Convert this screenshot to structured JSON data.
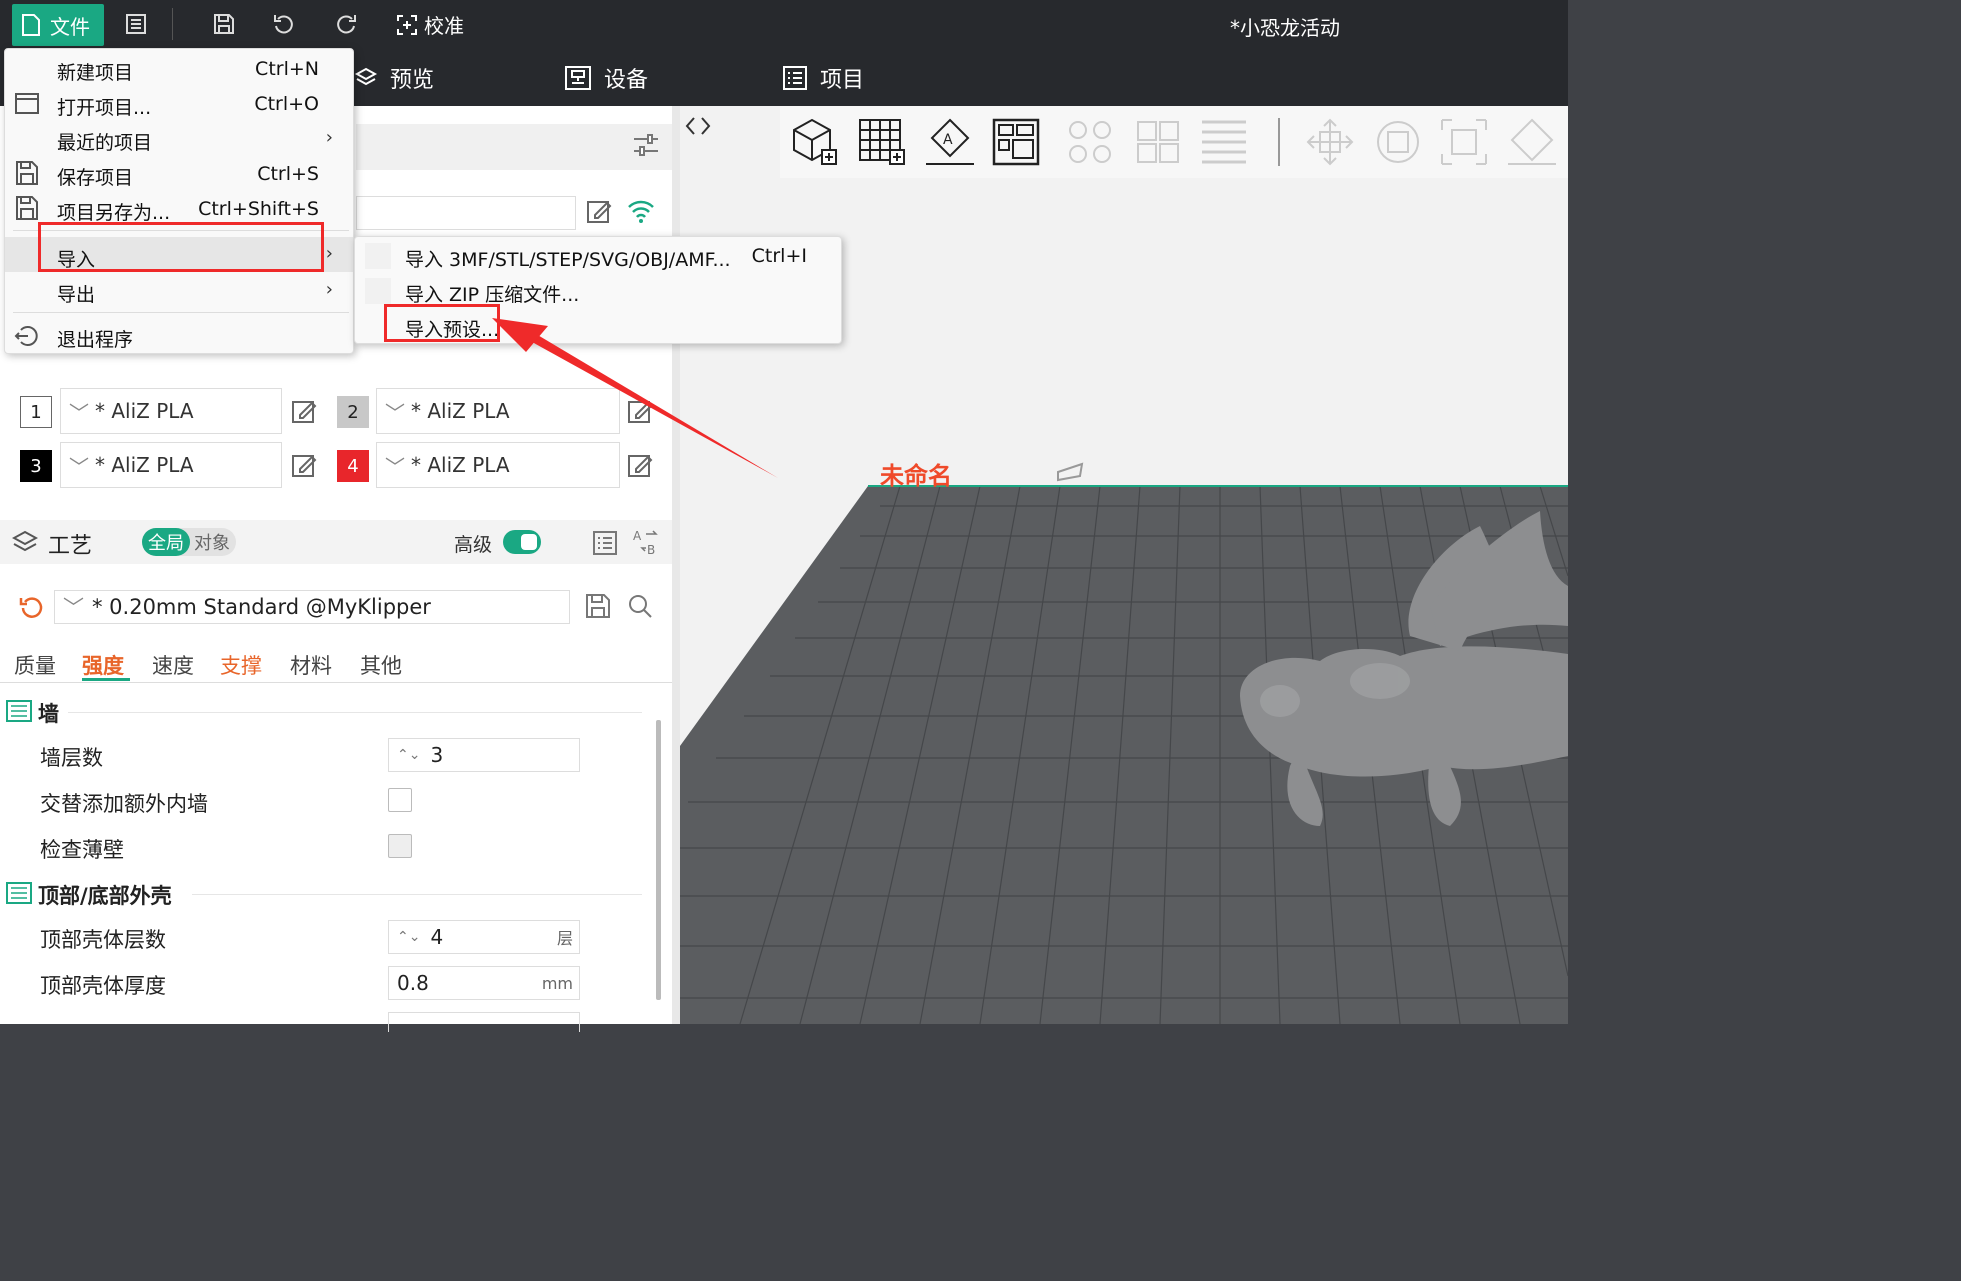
{
  "window_title": "*小恐龙活动",
  "topbar": {
    "file_label": "文件",
    "calibrate_label": "校准"
  },
  "navtabs": [
    {
      "label": "预览"
    },
    {
      "label": "设备"
    },
    {
      "label": "项目"
    }
  ],
  "file_menu": {
    "items": [
      {
        "label": "新建项目",
        "shortcut": "Ctrl+N"
      },
      {
        "label": "打开项目...",
        "shortcut": "Ctrl+O"
      },
      {
        "label": "最近的项目",
        "shortcut": ""
      },
      {
        "label": "保存项目",
        "shortcut": "Ctrl+S"
      },
      {
        "label": "项目另存为...",
        "shortcut": "Ctrl+Shift+S"
      },
      {
        "label": "导入",
        "shortcut": ""
      },
      {
        "label": "导出",
        "shortcut": ""
      },
      {
        "label": "退出程序",
        "shortcut": ""
      }
    ]
  },
  "import_submenu": {
    "items": [
      {
        "label": "导入 3MF/STL/STEP/SVG/OBJ/AMF...",
        "shortcut": "Ctrl+I"
      },
      {
        "label": "导入 ZIP 压缩文件...",
        "shortcut": ""
      },
      {
        "label": "导入预设..."
      }
    ]
  },
  "filaments": [
    {
      "num": "1",
      "name": "* AliZ PLA",
      "color": "#ffffff",
      "text_color": "#000000"
    },
    {
      "num": "2",
      "name": "* AliZ PLA",
      "color": "#c8c8c8",
      "text_color": "#000000"
    },
    {
      "num": "3",
      "name": "* AliZ PLA",
      "color": "#000000",
      "text_color": "#ffffff"
    },
    {
      "num": "4",
      "name": "* AliZ PLA",
      "color": "#e8262b",
      "text_color": "#ffffff"
    }
  ],
  "process": {
    "title": "工艺",
    "scope_global": "全局",
    "scope_object": "对象",
    "advanced_label": "高级",
    "advanced_on": true,
    "preset": "* 0.20mm Standard @MyKlipper",
    "tabs": [
      "质量",
      "强度",
      "速度",
      "支撑",
      "材料",
      "其他"
    ],
    "active_tab": "强度"
  },
  "settings": {
    "wall_group": "墙",
    "wall_loops_label": "墙层数",
    "wall_loops_value": "3",
    "alt_extra_wall_label": "交替添加额外内墙",
    "detect_thin_wall_label": "检查薄壁",
    "shell_group": "顶部/底部外壳",
    "top_shell_layers_label": "顶部壳体层数",
    "top_shell_layers_value": "4",
    "top_shell_layers_unit": "层",
    "top_shell_thickness_label": "顶部壳体厚度",
    "top_shell_thickness_value": "0.8",
    "top_shell_thickness_unit": "mm"
  },
  "plate": {
    "name": "未命名"
  },
  "colors": {
    "accent": "#1aa883",
    "highlight_red": "#ef2a2a",
    "plate": "#5b5d60"
  }
}
